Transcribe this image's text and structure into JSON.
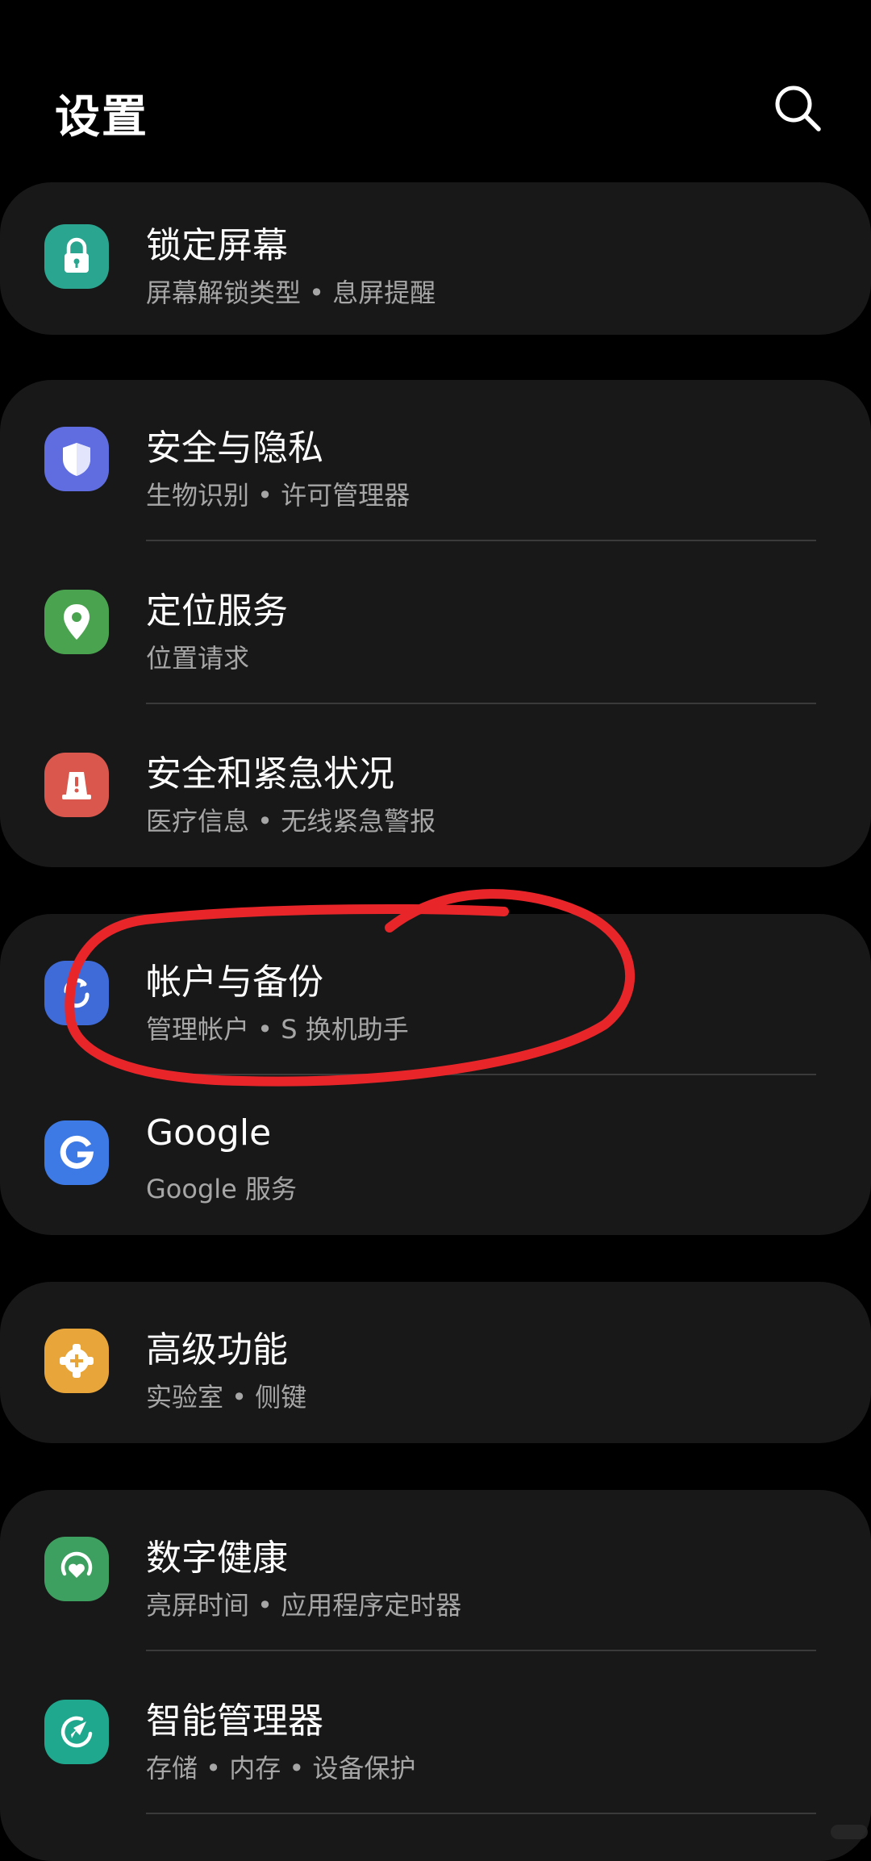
{
  "header": {
    "title": "设置",
    "search_icon": "search-icon"
  },
  "colors": {
    "background": "#000000",
    "card": "#181818",
    "subtitle": "#a6a6a6",
    "annotation_stroke": "#e8262a"
  },
  "groups": [
    {
      "items": [
        {
          "title": "锁定屏幕",
          "subtitle": "屏幕解锁类型 • 息屏提醒",
          "icon": "lock-icon",
          "icon_color": "#2aa58f"
        }
      ]
    },
    {
      "items": [
        {
          "title": "安全与隐私",
          "subtitle": "生物识别 • 许可管理器",
          "icon": "shield-icon",
          "icon_color": "#5f6de1"
        },
        {
          "title": "定位服务",
          "subtitle": "位置请求",
          "icon": "location-pin-icon",
          "icon_color": "#4aa34f"
        },
        {
          "title": "安全和紧急状况",
          "subtitle": "医疗信息 • 无线紧急警报",
          "icon": "emergency-alert-icon",
          "icon_color": "#d9574d"
        }
      ]
    },
    {
      "items": [
        {
          "title": "帐户与备份",
          "subtitle": "管理帐户 • S 换机助手",
          "icon": "sync-icon",
          "icon_color": "#3f6bd8"
        },
        {
          "title": "Google",
          "subtitle": "Google 服务",
          "icon": "google-icon",
          "icon_color": "#3d7ae6"
        }
      ]
    },
    {
      "items": [
        {
          "title": "高级功能",
          "subtitle": "实验室 • 侧键",
          "icon": "puzzle-gear-icon",
          "icon_color": "#e8a53a"
        }
      ]
    },
    {
      "items": [
        {
          "title": "数字健康",
          "subtitle": "亮屏时间 • 应用程序定时器",
          "icon": "heart-circle-icon",
          "icon_color": "#3ea060"
        },
        {
          "title": "智能管理器",
          "subtitle": "存储 • 内存 • 设备保护",
          "icon": "care-rocket-icon",
          "icon_color": "#1fa88d"
        }
      ]
    }
  ]
}
